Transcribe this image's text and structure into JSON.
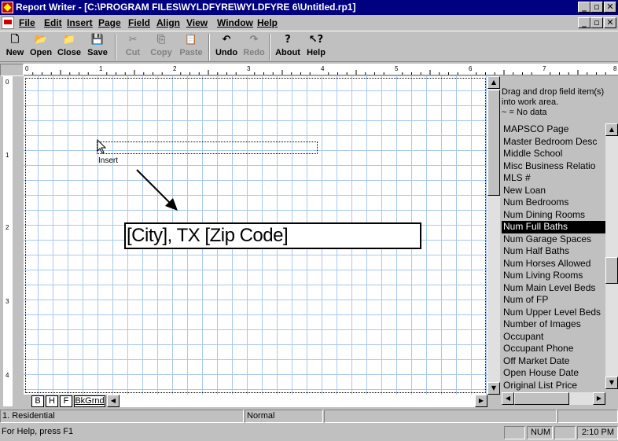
{
  "window": {
    "title": "Report Writer - [C:\\PROGRAM FILES\\WYLDFYRE\\WYLDFYRE 6\\Untitled.rp1]"
  },
  "menu": [
    "File",
    "Edit",
    "Insert",
    "Page",
    "Field",
    "Align",
    "View",
    "Window",
    "Help"
  ],
  "toolbar": [
    {
      "label": "New",
      "icon": "new-icon",
      "glyph": "🗋",
      "enabled": true
    },
    {
      "label": "Open",
      "icon": "open-icon",
      "glyph": "📂",
      "enabled": true
    },
    {
      "label": "Close",
      "icon": "close-doc-icon",
      "glyph": "📁",
      "enabled": true
    },
    {
      "label": "Save",
      "icon": "save-icon",
      "glyph": "💾",
      "enabled": true
    },
    {
      "label": "Cut",
      "icon": "cut-icon",
      "glyph": "✂",
      "enabled": false
    },
    {
      "label": "Copy",
      "icon": "copy-icon",
      "glyph": "⎘",
      "enabled": false
    },
    {
      "label": "Paste",
      "icon": "paste-icon",
      "glyph": "📋",
      "enabled": false
    },
    {
      "label": "Undo",
      "icon": "undo-icon",
      "glyph": "↶",
      "enabled": true
    },
    {
      "label": "Redo",
      "icon": "redo-icon",
      "glyph": "↷",
      "enabled": false
    },
    {
      "label": "About",
      "icon": "about-icon",
      "glyph": "?",
      "enabled": true
    },
    {
      "label": "Help",
      "icon": "help-pointer-icon",
      "glyph": "↖?",
      "enabled": true
    }
  ],
  "ruler": {
    "h_numbers": [
      "0",
      "1",
      "2",
      "3",
      "4",
      "5",
      "6",
      "7",
      "8"
    ],
    "v_numbers": [
      "0",
      "1",
      "2",
      "3",
      "4"
    ]
  },
  "canvas": {
    "insert_label": "Insert",
    "field_text": "[City], TX  [Zip Code]"
  },
  "tabs": [
    "B",
    "H",
    "F",
    "BkGrnd"
  ],
  "field_panel": {
    "hint": "Drag and drop field item(s) into work area.",
    "legend": "~ = No data",
    "items": [
      "MAPSCO Page",
      "Master Bedroom Desc",
      "Middle School",
      "Misc Business Relatio",
      "MLS #",
      "New Loan",
      "Num Bedrooms",
      "Num Dining Rooms",
      "Num Full Baths",
      "Num Garage Spaces",
      "Num Half Baths",
      "Num Horses Allowed",
      "Num Living Rooms",
      "Num Main Level Beds",
      "Num of FP",
      "Num Upper Level Beds",
      "Number of Images",
      "Occupant",
      "Occupant Phone",
      "Off Market Date",
      "Open House Date",
      "Original List Price"
    ],
    "selected": "Num Full Baths"
  },
  "status": {
    "layout": "1. Residential",
    "style": "Normal",
    "help": "For Help, press F1",
    "num": "NUM",
    "time": "2:10 PM"
  }
}
